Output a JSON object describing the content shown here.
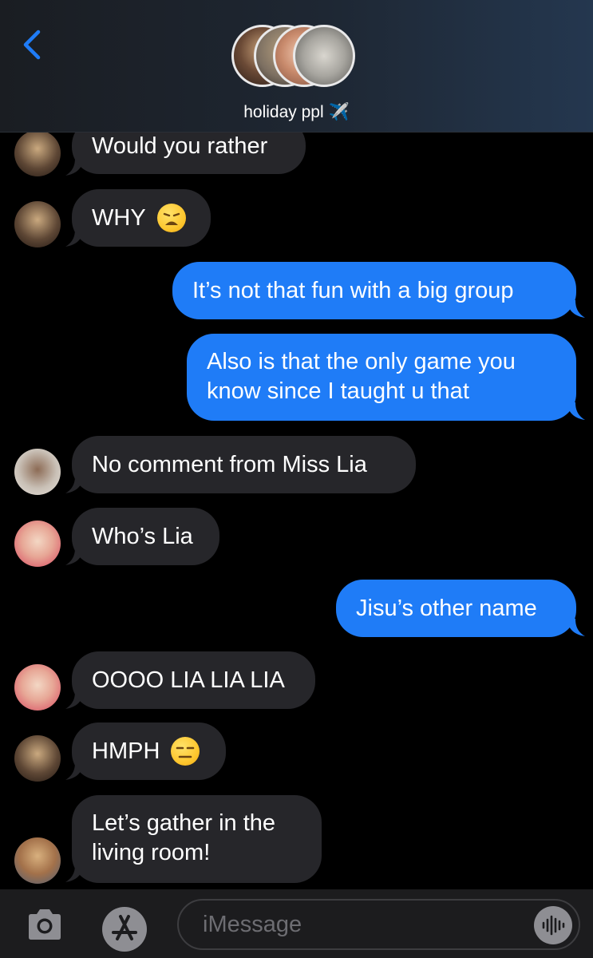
{
  "header": {
    "title": "holiday ppl",
    "title_emoji": "✈️",
    "back_icon": "chevron-left-icon",
    "accent": "#1f7cf7"
  },
  "messages": [
    {
      "sender": "incoming",
      "text": "Would you rather"
    },
    {
      "sender": "incoming",
      "text": "WHY",
      "emoji": "weary-face"
    },
    {
      "sender": "outgoing",
      "text": "It’s not that fun with a big group"
    },
    {
      "sender": "outgoing",
      "lines": [
        "Also is that the only game you",
        "know since I taught u that"
      ]
    },
    {
      "sender": "incoming",
      "text": "No comment from Miss Lia"
    },
    {
      "sender": "incoming",
      "text": "Who’s Lia"
    },
    {
      "sender": "outgoing",
      "text": "Jisu’s other name"
    },
    {
      "sender": "incoming",
      "text": "OOOO LIA LIA LIA"
    },
    {
      "sender": "incoming",
      "text": "HMPH",
      "emoji": "expressionless-face"
    },
    {
      "sender": "incoming",
      "lines": [
        "Let’s gather in the",
        "living room!"
      ]
    }
  ],
  "composer": {
    "placeholder": "iMessage",
    "camera_icon": "camera-icon",
    "apps_icon": "app-store-icon",
    "audio_icon": "audio-waveform-icon"
  },
  "colors": {
    "incoming_bubble": "#26262a",
    "outgoing_bubble": "#1f7cf7",
    "background": "#000000"
  }
}
